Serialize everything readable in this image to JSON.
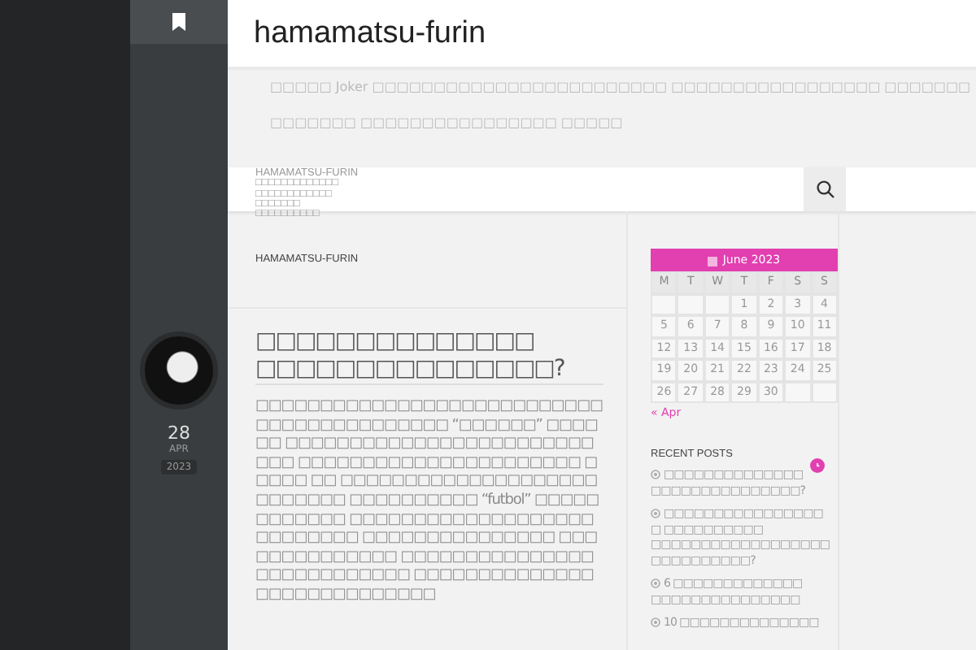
{
  "site": {
    "title": "hamamatsu-furin",
    "description": [
      "□□□□□ Joker □□□□□□□□□□□□□□□□□□□□□□□□ □□□□□□□□□□□□□□□□□ □□□□□□□",
      "□□□□□□□ □□□□□□□□□□□□□□□□ □□□□□"
    ]
  },
  "nav": {
    "items": [
      {
        "label": "HAMAMATSU-FURIN"
      },
      {
        "label": "□□□□□□□□□□□□□"
      },
      {
        "label": "□□□□□□□□□□□□"
      },
      {
        "label": "□□□□□□□"
      },
      {
        "label": "□□□□□□□□□□"
      }
    ]
  },
  "breadcrumb": "HAMAMATSU-FURIN",
  "post": {
    "day": "28",
    "month": "APR",
    "year": "2023",
    "title": "□□□□□□□□□□□□□□ □□□□□□□□□□□□□□□?",
    "body": "□□□□□□□□□□□□□□□□□□□□□□□□□□□ □□□□□□□□□□□□□□□ “□□□□□□” □□□□□□ □□□□□□□□□□□□□□□□□□□□□□□□□□□ □□□□□□□□□□□□□□□□□□□□□□ □□□□□ □□ □□□□□□□□□□□□□□□□□□□□□□□□□□□ □□□□□□□□□□ “futbol” □□□□□□□□□□□□ □□□□□□□□□□□□□□□□□□□□□□□□□□□ □□□□□□□□□□□□□□□ □□□□□□□□□□□□□□ □□□□□□□□□□□□□□□□□□□□□□□□□□□ □□□□□□□□□□□□□□□□□□□□□□□□□□□□"
  },
  "calendar": {
    "title": "June 2023",
    "weekdays": [
      "M",
      "T",
      "W",
      "T",
      "F",
      "S",
      "S"
    ],
    "days": [
      {
        "kind": "blank"
      },
      {
        "kind": "blank"
      },
      {
        "kind": "blank"
      },
      {
        "kind": "day",
        "label": "1"
      },
      {
        "kind": "day",
        "label": "2"
      },
      {
        "kind": "day",
        "label": "3"
      },
      {
        "kind": "day",
        "label": "4"
      },
      {
        "kind": "day",
        "label": "5"
      },
      {
        "kind": "day",
        "label": "6"
      },
      {
        "kind": "day",
        "label": "7"
      },
      {
        "kind": "day",
        "label": "8"
      },
      {
        "kind": "day",
        "label": "9"
      },
      {
        "kind": "day",
        "label": "10"
      },
      {
        "kind": "day",
        "label": "11"
      },
      {
        "kind": "day",
        "label": "12"
      },
      {
        "kind": "day",
        "label": "13"
      },
      {
        "kind": "day",
        "label": "14"
      },
      {
        "kind": "day",
        "label": "15"
      },
      {
        "kind": "day",
        "label": "16"
      },
      {
        "kind": "day",
        "label": "17"
      },
      {
        "kind": "day",
        "label": "18"
      },
      {
        "kind": "day",
        "label": "19"
      },
      {
        "kind": "day",
        "label": "20"
      },
      {
        "kind": "day",
        "label": "21"
      },
      {
        "kind": "day",
        "label": "22"
      },
      {
        "kind": "day",
        "label": "23"
      },
      {
        "kind": "day",
        "label": "24"
      },
      {
        "kind": "day",
        "label": "25"
      },
      {
        "kind": "day",
        "label": "26"
      },
      {
        "kind": "day",
        "label": "27"
      },
      {
        "kind": "day",
        "label": "28"
      },
      {
        "kind": "day",
        "label": "29"
      },
      {
        "kind": "day",
        "label": "30"
      },
      {
        "kind": "blank"
      },
      {
        "kind": "blank"
      }
    ],
    "prev": "« Apr"
  },
  "recent_posts": {
    "title": "RECENT POSTS",
    "items": [
      "□□□□□□□□□□□□□□ □□□□□□□□□□□□□□□?",
      "□□□□□□□□□□□□□□□□ □ □□□□□□□□□□ □□□□□□□□□□□□□□□□□□ □□□□□□□□□□?",
      "6 □□□□□□□□□□□□□ □□□□□□□□□□□□□□□",
      "10 □□□□□□□□□□□□□□"
    ]
  }
}
